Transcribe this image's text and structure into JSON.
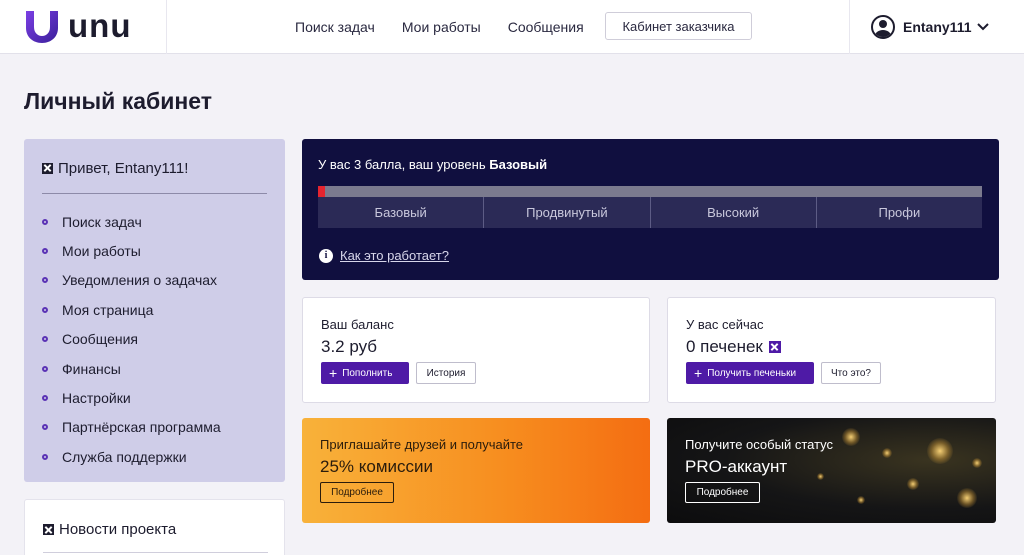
{
  "header": {
    "logo_text": "unu",
    "nav": [
      "Поиск задач",
      "Мои работы",
      "Сообщения"
    ],
    "customer_button": "Кабинет заказчика",
    "username": "Entany111"
  },
  "page_title": "Личный кабинет",
  "sidebar": {
    "greeting": "Привет, Entany111!",
    "items": [
      "Поиск задач",
      "Мои работы",
      "Уведомления о задачах",
      "Моя страница",
      "Сообщения",
      "Финансы",
      "Настройки",
      "Партнёрская программа",
      "Служба поддержки"
    ],
    "news_title": "Новости проекта"
  },
  "level_card": {
    "text_prefix": "У вас 3 балла, ваш уровень ",
    "current_level": "Базовый",
    "progress_fraction": 0.01,
    "levels": [
      "Базовый",
      "Продвинутый",
      "Высокий",
      "Профи"
    ],
    "how_link": "Как это работает?"
  },
  "balance_card": {
    "label": "Ваш баланс",
    "value": "3.2 руб",
    "topup_button": "Пополнить",
    "history_button": "История"
  },
  "cookies_card": {
    "label": "У вас сейчас",
    "value": "0 печенек",
    "get_button": "Получить печеньки",
    "what_button": "Что это?"
  },
  "referral_card": {
    "line1": "Приглашайте друзей и получайте",
    "line2": "25% комиссии",
    "button": "Подробнее"
  },
  "pro_card": {
    "line1": "Получите особый статус",
    "line2": "PRO-аккаунт",
    "button": "Подробнее"
  },
  "colors": {
    "brand_purple": "#4e1aa6",
    "navy": "#100f3f",
    "sidebar_bg": "#cfcde8",
    "progress_red": "#e5242f",
    "orange": "#f78c1e"
  }
}
